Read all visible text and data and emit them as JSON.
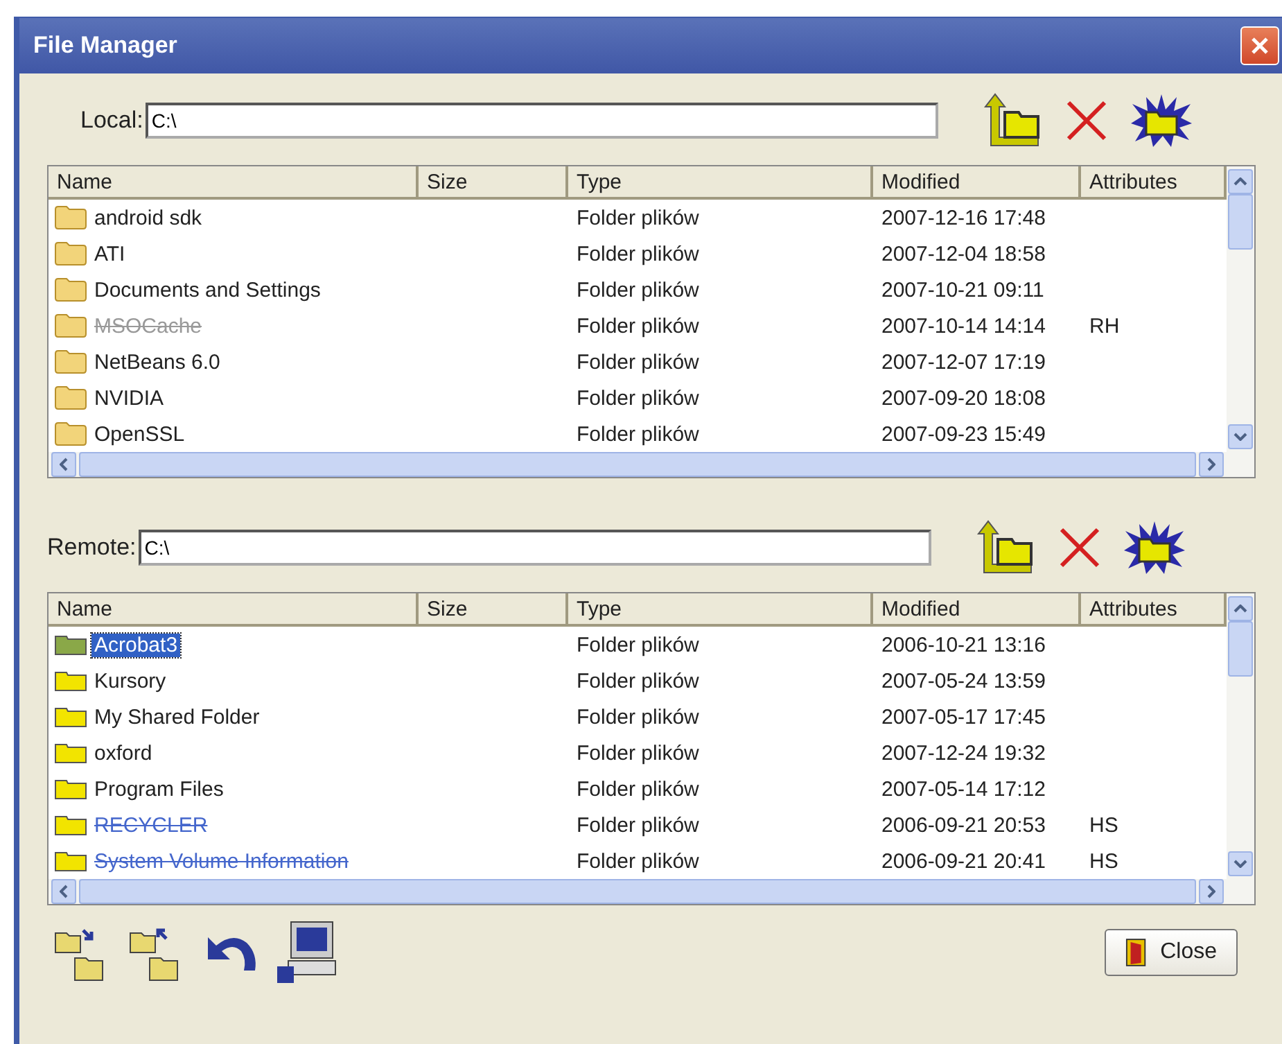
{
  "window": {
    "title": "File Manager"
  },
  "panels": [
    {
      "kind": "local",
      "label": "Local:",
      "path": "C:\\",
      "columns": [
        "Name",
        "Size",
        "Type",
        "Modified",
        "Attributes"
      ],
      "rows": [
        {
          "name": "android sdk",
          "size": "",
          "type": "Folder plików",
          "modified": "2007-12-16 17:48",
          "attributes": "",
          "hidden": false,
          "selected": false
        },
        {
          "name": "ATI",
          "size": "",
          "type": "Folder plików",
          "modified": "2007-12-04 18:58",
          "attributes": "",
          "hidden": false,
          "selected": false
        },
        {
          "name": "Documents and Settings",
          "size": "",
          "type": "Folder plików",
          "modified": "2007-10-21 09:11",
          "attributes": "",
          "hidden": false,
          "selected": false
        },
        {
          "name": "MSOCache",
          "size": "",
          "type": "Folder plików",
          "modified": "2007-10-14 14:14",
          "attributes": "RH",
          "hidden": true,
          "selected": false
        },
        {
          "name": "NetBeans 6.0",
          "size": "",
          "type": "Folder plików",
          "modified": "2007-12-07 17:19",
          "attributes": "",
          "hidden": false,
          "selected": false
        },
        {
          "name": "NVIDIA",
          "size": "",
          "type": "Folder plików",
          "modified": "2007-09-20 18:08",
          "attributes": "",
          "hidden": false,
          "selected": false
        },
        {
          "name": "OpenSSL",
          "size": "",
          "type": "Folder plików",
          "modified": "2007-09-23 15:49",
          "attributes": "",
          "hidden": false,
          "selected": false
        }
      ]
    },
    {
      "kind": "remote",
      "label": "Remote:",
      "path": "C:\\",
      "columns": [
        "Name",
        "Size",
        "Type",
        "Modified",
        "Attributes"
      ],
      "rows": [
        {
          "name": "Acrobat3",
          "size": "",
          "type": "Folder plików",
          "modified": "2006-10-21 13:16",
          "attributes": "",
          "hidden": false,
          "selected": true
        },
        {
          "name": "Kursory",
          "size": "",
          "type": "Folder plików",
          "modified": "2007-05-24 13:59",
          "attributes": "",
          "hidden": false,
          "selected": false
        },
        {
          "name": "My Shared Folder",
          "size": "",
          "type": "Folder plików",
          "modified": "2007-05-17 17:45",
          "attributes": "",
          "hidden": false,
          "selected": false
        },
        {
          "name": "oxford",
          "size": "",
          "type": "Folder plików",
          "modified": "2007-12-24 19:32",
          "attributes": "",
          "hidden": false,
          "selected": false
        },
        {
          "name": "Program Files",
          "size": "",
          "type": "Folder plików",
          "modified": "2007-05-14 17:12",
          "attributes": "",
          "hidden": false,
          "selected": false
        },
        {
          "name": "RECYCLER",
          "size": "",
          "type": "Folder plików",
          "modified": "2006-09-21 20:53",
          "attributes": "HS",
          "hidden": true,
          "selected": false
        },
        {
          "name": "System Volume Information",
          "size": "",
          "type": "Folder plików",
          "modified": "2006-09-21 20:41",
          "attributes": "HS",
          "hidden": true,
          "selected": false
        }
      ]
    }
  ],
  "close_button": {
    "label": "Close"
  }
}
